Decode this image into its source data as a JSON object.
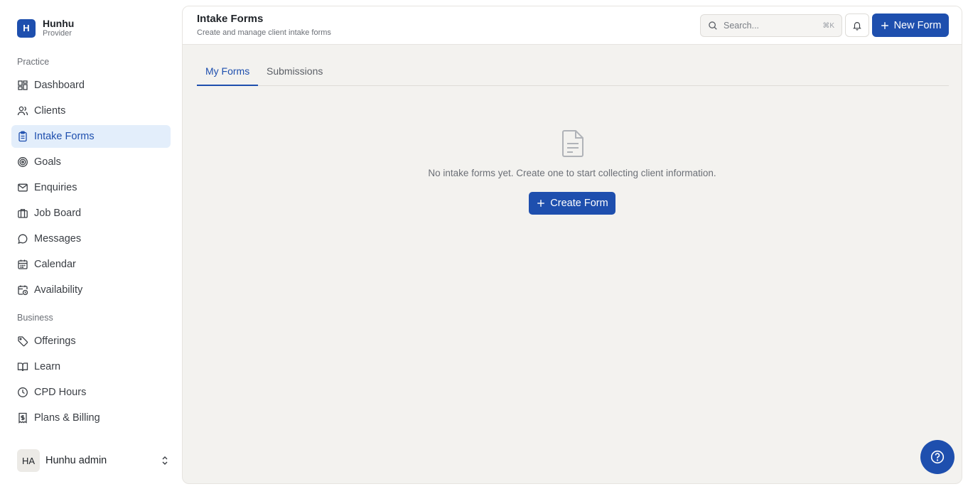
{
  "brand": {
    "initial": "H",
    "name": "Hunhu",
    "role": "Provider"
  },
  "sidebar": {
    "sections": [
      {
        "label": "Practice"
      },
      {
        "label": "Business"
      }
    ],
    "items": [
      {
        "label": "Dashboard",
        "icon": "dashboard-icon"
      },
      {
        "label": "Clients",
        "icon": "users-icon"
      },
      {
        "label": "Intake Forms",
        "icon": "clipboard-icon",
        "active": true
      },
      {
        "label": "Goals",
        "icon": "target-icon"
      },
      {
        "label": "Enquiries",
        "icon": "mail-icon"
      },
      {
        "label": "Job Board",
        "icon": "briefcase-icon"
      },
      {
        "label": "Messages",
        "icon": "message-icon"
      },
      {
        "label": "Calendar",
        "icon": "calendar-icon"
      },
      {
        "label": "Availability",
        "icon": "calendar-clock-icon"
      },
      {
        "label": "Offerings",
        "icon": "tag-icon"
      },
      {
        "label": "Learn",
        "icon": "book-icon"
      },
      {
        "label": "CPD Hours",
        "icon": "clock-icon"
      },
      {
        "label": "Plans & Billing",
        "icon": "receipt-icon"
      }
    ]
  },
  "user": {
    "initials": "HA",
    "name": "Hunhu admin"
  },
  "header": {
    "title": "Intake Forms",
    "subtitle": "Create and manage client intake forms",
    "search_placeholder": "Search...",
    "search_shortcut": "⌘K",
    "new_button": "New Form"
  },
  "tabs": [
    {
      "label": "My Forms",
      "active": true
    },
    {
      "label": "Submissions",
      "active": false
    }
  ],
  "empty_state": {
    "message": "No intake forms yet. Create one to start collecting client information.",
    "button": "Create Form"
  },
  "colors": {
    "accent": "#1e4fae",
    "active_bg": "#e3eefb",
    "main_bg": "#f3f2ef"
  }
}
